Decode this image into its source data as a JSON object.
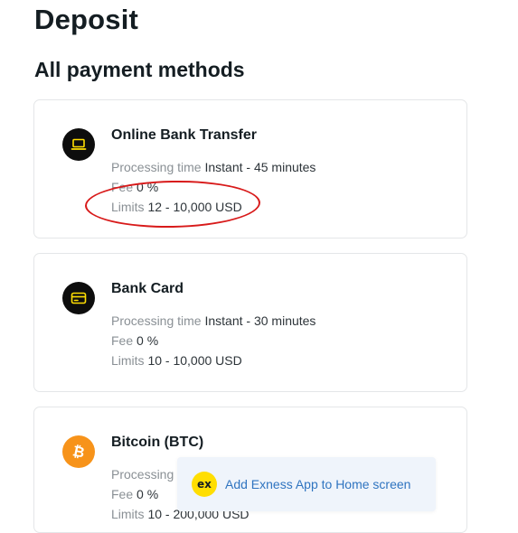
{
  "page": {
    "title": "Deposit",
    "section_title": "All payment methods"
  },
  "methods": [
    {
      "name": "Online Bank Transfer",
      "icon": "laptop-icon",
      "processing_label": "Processing time",
      "processing_value": "Instant - 45 minutes",
      "fee_label": "Fee",
      "fee_value": "0 %",
      "limits_label": "Limits",
      "limits_value": "12 - 10,000 USD"
    },
    {
      "name": "Bank Card",
      "icon": "bank-card-icon",
      "processing_label": "Processing time",
      "processing_value": "Instant - 30 minutes",
      "fee_label": "Fee",
      "fee_value": "0 %",
      "limits_label": "Limits",
      "limits_value": "10 - 10,000 USD"
    },
    {
      "name": "Bitcoin (BTC)",
      "icon": "bitcoin-icon",
      "processing_label": "Processing",
      "fee_label": "Fee",
      "fee_value": "0 %",
      "limits_label": "Limits",
      "limits_value": "10 - 200,000 USD"
    }
  ],
  "banner": {
    "logo_text": "ex",
    "text": "Add Exness App to Home screen"
  },
  "colors": {
    "text_primary": "#141d22",
    "text_label": "#8a9095",
    "annotation_red": "#d81a1a",
    "icon_dark": "#0d0d0d",
    "bitcoin_orange": "#f7931a",
    "exness_yellow": "#ffde02",
    "link_blue": "#2f74c0",
    "banner_bg": "#eff4fb"
  }
}
